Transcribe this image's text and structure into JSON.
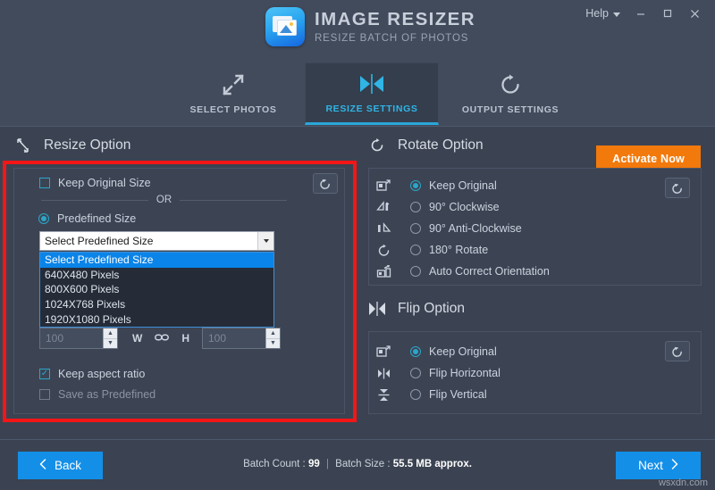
{
  "titlebar": {
    "app_title": "IMAGE RESIZER",
    "app_subtitle": "RESIZE BATCH OF PHOTOS",
    "logo_icon": "image-stack-icon",
    "help_label": "Help",
    "help_chevron_icon": "chevron-down-icon",
    "minimize_icon": "minimize-icon",
    "minimize_glyph": "—",
    "maximize_icon": "maximize-icon",
    "maximize_glyph": "▢",
    "close_icon": "close-icon",
    "close_glyph": "✕"
  },
  "tabs": [
    {
      "label": "SELECT PHOTOS",
      "icon": "expand-arrows-icon",
      "active": false
    },
    {
      "label": "RESIZE SETTINGS",
      "icon": "resize-hourglass-icon",
      "active": true
    },
    {
      "label": "OUTPUT SETTINGS",
      "icon": "refresh-circle-icon",
      "active": false
    }
  ],
  "activate": {
    "label": "Activate Now"
  },
  "resize_section": {
    "header": "Resize Option",
    "header_icon": "diagonal-resize-icon",
    "reset_icon": "reset-arrow-icon",
    "keep_original_size": {
      "label": "Keep Original Size",
      "checked": false
    },
    "or_text": "OR",
    "predefined_size": {
      "label": "Predefined Size",
      "selected": true
    },
    "combo": {
      "value": "Select Predefined Size",
      "arrow_icon": "chevron-down-icon",
      "expanded": true,
      "options": [
        "Select Predefined Size",
        "640X480 Pixels",
        "800X600 Pixels",
        "1024X768 Pixels",
        "1920X1080 Pixels"
      ],
      "selected_index": 0
    },
    "width_input": {
      "value": "100",
      "placeholder": "100"
    },
    "height_input": {
      "value": "100",
      "placeholder": "100"
    },
    "width_label": "W",
    "height_label": "H",
    "link_icon": "chain-link-icon",
    "keep_aspect_ratio": {
      "label": "Keep aspect ratio",
      "checked": true
    },
    "save_as_predefined": {
      "label": "Save as Predefined",
      "checked": false,
      "disabled": true
    }
  },
  "rotate_section": {
    "header": "Rotate Option",
    "header_icon": "refresh-circle-icon",
    "reset_icon": "reset-arrow-icon",
    "options": [
      {
        "label": "Keep Original",
        "icon": "keep-original-icon",
        "selected": true
      },
      {
        "label": "90° Clockwise",
        "icon": "rotate-cw-90-icon",
        "selected": false
      },
      {
        "label": "90° Anti-Clockwise",
        "icon": "rotate-ccw-90-icon",
        "selected": false
      },
      {
        "label": "180° Rotate",
        "icon": "rotate-180-icon",
        "selected": false
      },
      {
        "label": "Auto Correct Orientation",
        "icon": "auto-orient-icon",
        "selected": false
      }
    ]
  },
  "flip_section": {
    "header": "Flip Option",
    "header_icon": "flip-hourglass-icon",
    "reset_icon": "reset-arrow-icon",
    "options": [
      {
        "label": "Keep Original",
        "icon": "keep-original-icon",
        "selected": true
      },
      {
        "label": "Flip Horizontal",
        "icon": "flip-horizontal-icon",
        "selected": false
      },
      {
        "label": "Flip Vertical",
        "icon": "flip-vertical-icon",
        "selected": false
      }
    ]
  },
  "bottombar": {
    "back_label": "Back",
    "back_icon": "chevron-left-icon",
    "next_label": "Next",
    "next_icon": "chevron-right-icon",
    "batch_count_label": "Batch Count :",
    "batch_count_value": "99",
    "separator": "|",
    "batch_size_label": "Batch Size :",
    "batch_size_value": "55.5 MB approx.",
    "watermark": "wsxdn.com"
  },
  "colors": {
    "accent_cyan": "#2fb5e6",
    "accent_blue": "#138fe8",
    "accent_orange": "#f2790c",
    "highlight_red": "#f41616",
    "panel_bg": "#3c4454",
    "window_bg": "#3b4352",
    "header_bg": "#414b5c",
    "list_select_blue": "#0a84e8"
  }
}
